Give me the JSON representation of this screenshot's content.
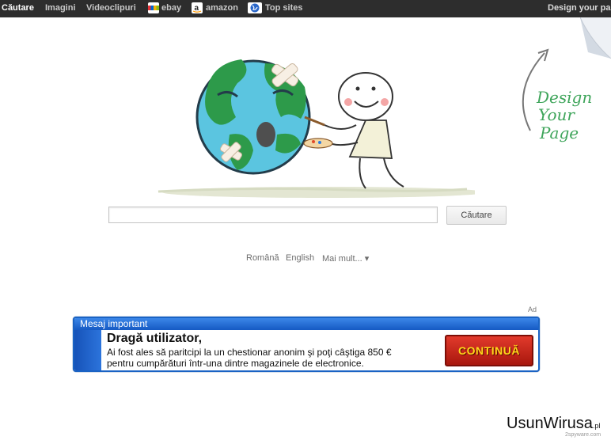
{
  "topbar": {
    "items": [
      {
        "label": "Căutare",
        "active": true
      },
      {
        "label": "Imagini"
      },
      {
        "label": "Videoclipuri"
      },
      {
        "label": "ebay",
        "icon": "ebay-icon"
      },
      {
        "label": "amazon",
        "icon": "amazon-icon"
      },
      {
        "label": "Top sites",
        "icon": "globe-icon"
      }
    ],
    "design_link": "Design your page"
  },
  "design_your_page_art": [
    "Design",
    "Your",
    "Page"
  ],
  "search": {
    "value": "",
    "button_label": "Căutare"
  },
  "languages": {
    "items": [
      "Română",
      "English"
    ],
    "more": "Mai mult... ▾"
  },
  "ad": {
    "label": "Ad",
    "header": "Mesaj important",
    "title": "Dragă utilizator,",
    "line1": "Ai fost ales să paritcipi la un chestionar anonim şi poţi câştiga 850 €",
    "line2": "pentru cumpărături într-una dintre magazinele de electronice.",
    "cta": "CONTINUĂ"
  },
  "watermark": {
    "main": "UsunWirusa",
    "tld": ".pl",
    "sub": "2spyware.com"
  },
  "colors": {
    "topbar": "#2d2d2d",
    "ad_blue": "#1a63c4",
    "cta_red": "#c4281c",
    "cta_text": "#ffd81a",
    "design_green": "#3fa55b"
  }
}
